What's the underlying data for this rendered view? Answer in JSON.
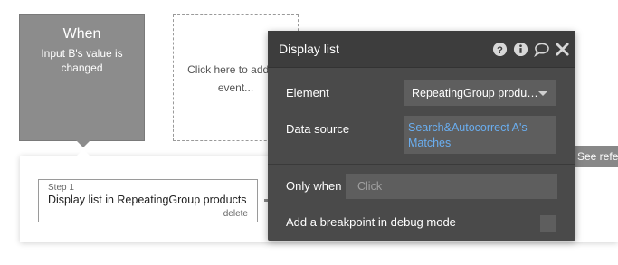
{
  "event_card": {
    "title": "When",
    "description": "Input B's value is changed"
  },
  "add_event": {
    "line1": "Click here to add an",
    "line2": "event..."
  },
  "step": {
    "number_label": "Step 1",
    "title": "Display list in RepeatingGroup products",
    "delete_label": "delete"
  },
  "see_reference": {
    "icon": "question-icon",
    "label": "See reference"
  },
  "panel": {
    "title": "Display list",
    "header_icons": [
      "help-circle-icon",
      "info-circle-icon",
      "comment-icon",
      "close-icon"
    ],
    "element": {
      "label": "Element",
      "value": "RepeatingGroup products"
    },
    "data_source": {
      "label": "Data source",
      "value": "Search&Autocorrect A's Matches"
    },
    "only_when": {
      "label": "Only when",
      "placeholder": "Click"
    },
    "breakpoint": {
      "label": "Add a breakpoint in debug mode",
      "checked": false
    }
  },
  "colors": {
    "panel_bg": "#4a4a4a",
    "panel_header_bg": "#3d3d3d",
    "field_bg": "#5e5e5e",
    "link_blue": "#6aaef0",
    "event_card_bg": "#8c8c8c"
  }
}
